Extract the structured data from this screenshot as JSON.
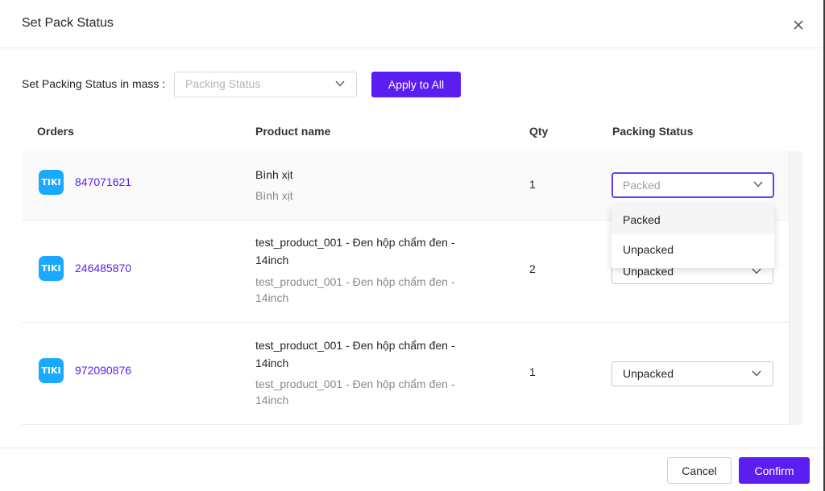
{
  "dialog": {
    "title": "Set Pack Status"
  },
  "mass": {
    "label": "Set Packing Status in mass :",
    "placeholder": "Packing Status",
    "apply_label": "Apply to All"
  },
  "table": {
    "headers": [
      "Orders",
      "Product name",
      "Qty",
      "Packing Status"
    ],
    "rows": [
      {
        "platform": "TIKI",
        "order": "847071621",
        "product": "Bình xịt",
        "product_sub": "Bình xịt",
        "qty": "1",
        "status": "Packed"
      },
      {
        "platform": "TIKI",
        "order": "246485870",
        "product": "test_product_001 - Đen hộp chẩm đen - 14inch",
        "product_sub": "test_product_001 - Đen hộp chẩm đen - 14inch",
        "qty": "2",
        "status": "Unpacked"
      },
      {
        "platform": "TIKI",
        "order": "972090876",
        "product": "test_product_001 - Đen hộp chẩm đen - 14inch",
        "product_sub": "test_product_001 - Đen hộp chẩm đen - 14inch",
        "qty": "1",
        "status": "Unpacked"
      }
    ]
  },
  "dropdown": {
    "options": [
      "Packed",
      "Unpacked"
    ],
    "selected": "Packed"
  },
  "footer": {
    "cancel_label": "Cancel",
    "confirm_label": "Confirm"
  },
  "colors": {
    "accent": "#5b1ef0",
    "tiki": "#1ba8ff"
  },
  "icons": {
    "close": "close-icon",
    "chevron": "chevron-down-icon",
    "logo": "tiki-logo"
  }
}
